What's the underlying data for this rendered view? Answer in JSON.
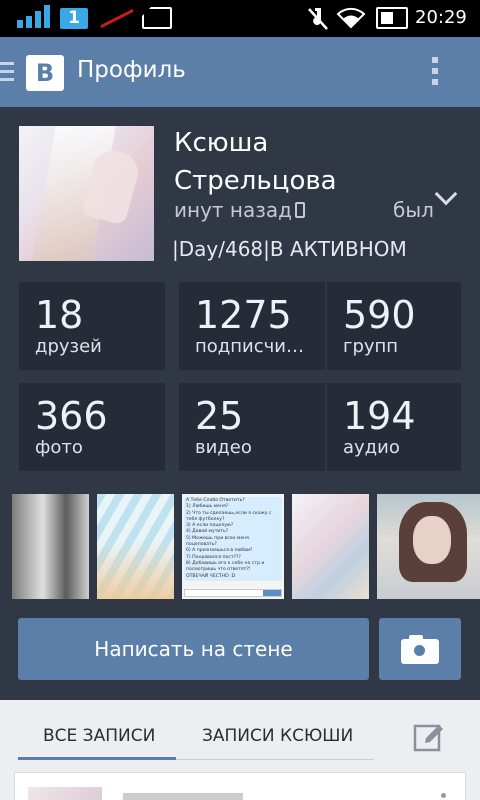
{
  "status_bar": {
    "sim_number": "1",
    "time": "20:29"
  },
  "app_bar": {
    "logo": "В",
    "title": "Профиль"
  },
  "profile": {
    "name_line1": "Ксюша",
    "name_line2": "Стрельцова",
    "last_seen": "инут назад",
    "was": "был",
    "status": "|Day/468|В АКТИВНОМ"
  },
  "stats": [
    {
      "value": "18",
      "label": "друзей"
    },
    {
      "value": "1275",
      "label": "подписчиков"
    },
    {
      "value": "590",
      "label": "групп"
    },
    {
      "value": "366",
      "label": "фото"
    },
    {
      "value": "25",
      "label": "видео"
    },
    {
      "value": "194",
      "label": "аудио"
    }
  ],
  "photo_chat_lines": [
    "А Тебе Слабо Ответить?",
    "1) Любишь меня?",
    "2) Что ты сделаешь,если я скажу с тебя футболку?",
    "3) А если поцелую?",
    "4) Давай мутить?",
    "5) Можешь при всех меня поцеловать?",
    "6) А признаешься в любви?",
    "7) Понравился пост???",
    "8) Добавишь его к себе на стр.и посмотришь что ответят?!",
    "ОТВЕЧАЙ ЧЕСТНО :D"
  ],
  "actions": {
    "write_wall": "Написать на стене"
  },
  "tabs": {
    "all_posts": "ВСЕ ЗАПИСИ",
    "user_posts": "ЗАПИСИ КСЮШИ"
  },
  "colors": {
    "accent": "#5b7fa8",
    "background": "#303745",
    "tile": "#262c37",
    "signal": "#3aa8e6"
  }
}
